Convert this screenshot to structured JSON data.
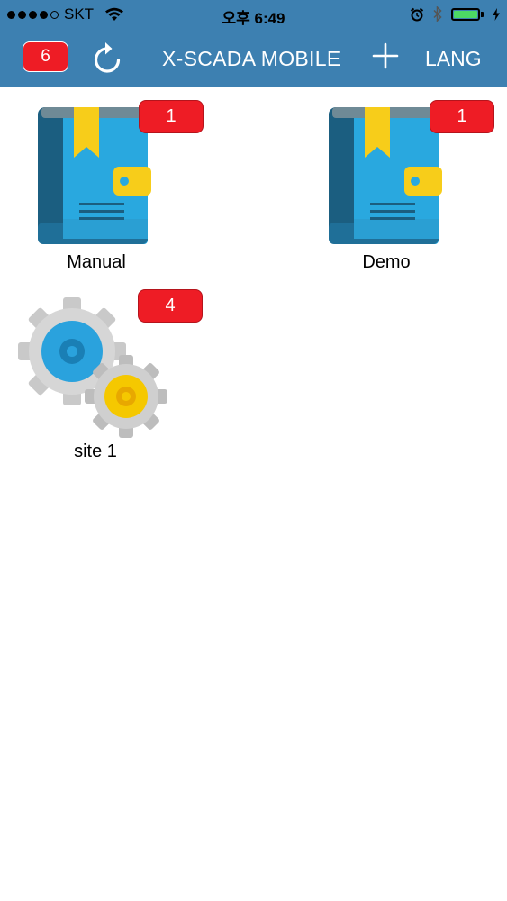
{
  "status_bar": {
    "carrier": "SKT",
    "time": "오후 6:49",
    "icons": [
      "signal-dots-icon",
      "wifi-icon",
      "alarm-icon",
      "bluetooth-icon",
      "battery-icon",
      "charging-icon"
    ]
  },
  "nav": {
    "alert_count": "6",
    "title": "X-SCADA MOBILE",
    "lang_label": "LANG",
    "icons": [
      "refresh-icon",
      "plus-icon"
    ]
  },
  "items": [
    {
      "label": "Manual",
      "badge": "1",
      "icon": "book-icon"
    },
    {
      "label": "Demo",
      "badge": "1",
      "icon": "book-icon"
    },
    {
      "label": "site 1",
      "badge": "4",
      "icon": "gears-icon"
    }
  ],
  "colors": {
    "nav_background": "#3d80b1",
    "badge_red": "#ee1c25",
    "battery_green": "#4cd964",
    "book_blue": "#29a8df",
    "book_dark": "#1b5e80",
    "bookmark_yellow": "#f7cd1a"
  }
}
